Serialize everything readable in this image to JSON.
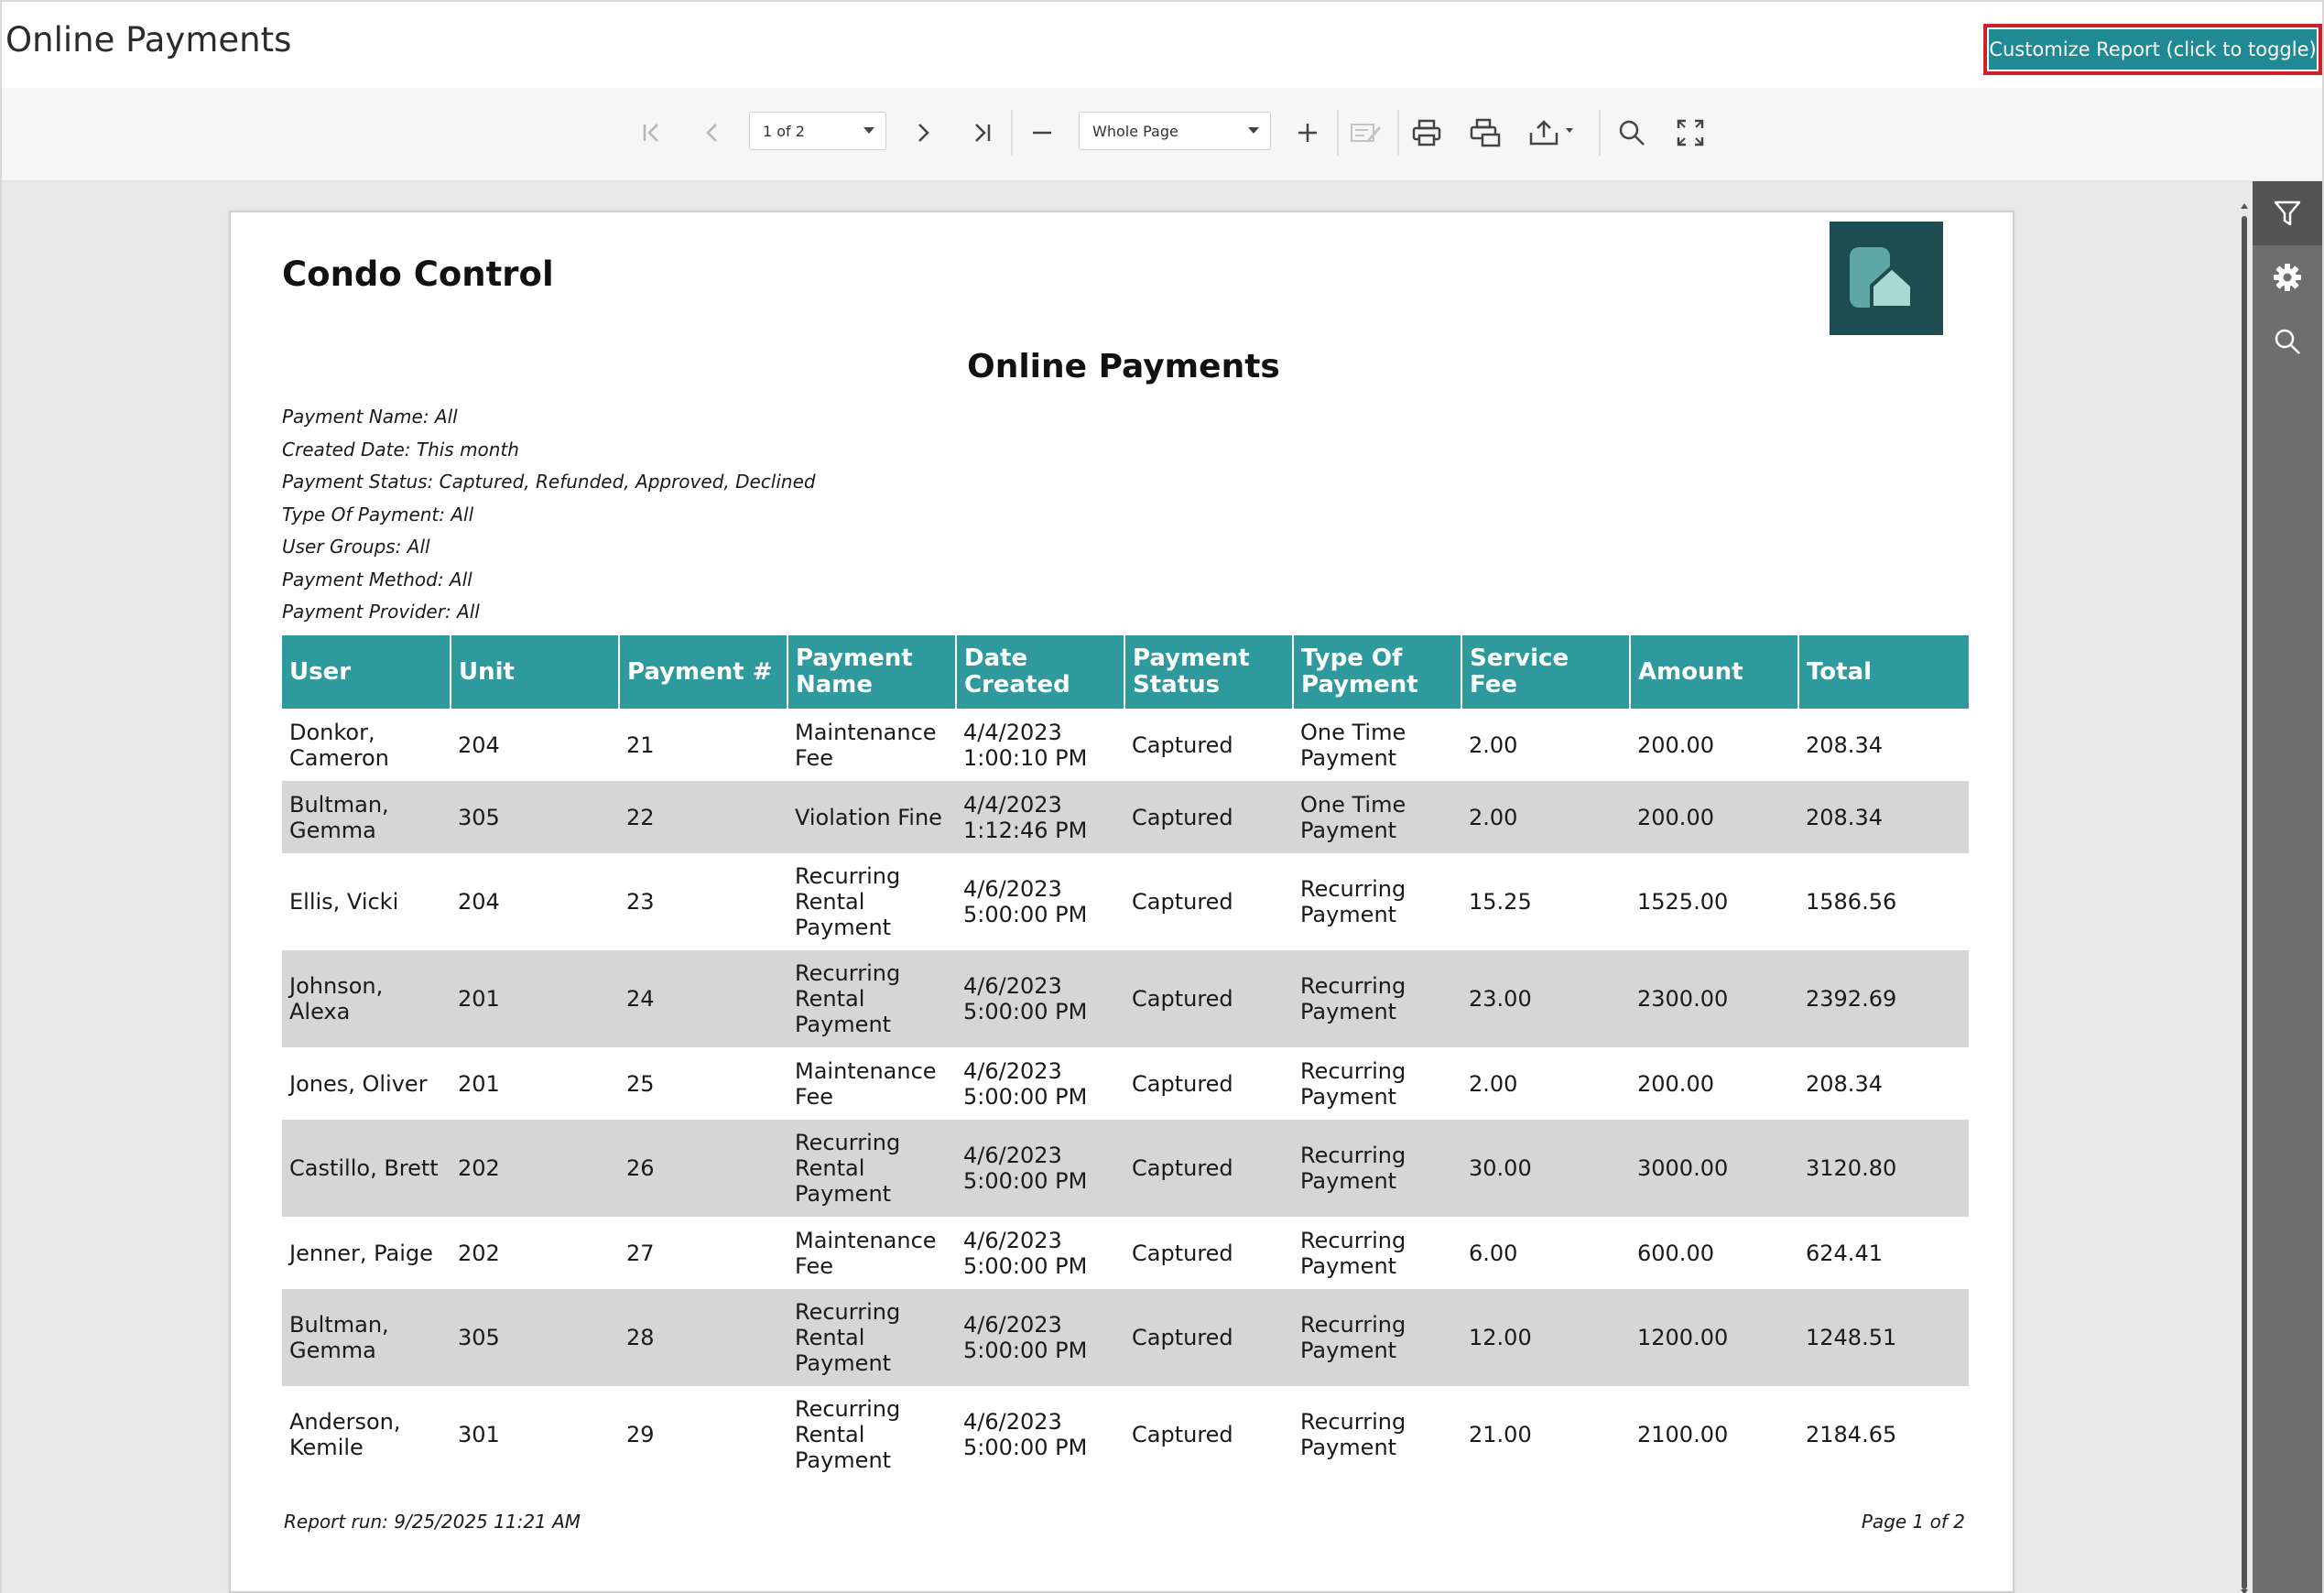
{
  "app": {
    "title": "Online Payments",
    "customize_button": "Customize Report (click to toggle)"
  },
  "toolbar": {
    "page_select": "1 of 2",
    "zoom_select": "Whole Page",
    "icons": [
      "first-page-icon",
      "prev-page-icon",
      "next-page-icon",
      "last-page-icon",
      "zoom-out-icon",
      "zoom-in-icon",
      "edit-fields-icon",
      "print-icon",
      "print-page-icon",
      "export-icon",
      "search-icon",
      "fullscreen-icon"
    ]
  },
  "sidepanel": {
    "icons": [
      "filter-icon",
      "gear-icon",
      "search-icon"
    ]
  },
  "report": {
    "company": "Condo Control",
    "title": "Online Payments",
    "filters": [
      "Payment Name: All",
      "Created Date: This month",
      "Payment Status: Captured, Refunded, Approved, Declined",
      "Type Of Payment: All",
      "User Groups: All",
      "Payment Method: All",
      "Payment Provider: All"
    ],
    "columns": [
      "User",
      "Unit",
      "Payment #",
      "Payment Name",
      "Date Created",
      "Payment Status",
      "Type Of Payment",
      "Service Fee",
      "Amount",
      "Total"
    ],
    "rows": [
      {
        "user": "Donkor, Cameron",
        "unit": "204",
        "payment_no": "21",
        "payment_name": "Maintenance Fee",
        "date_created": "4/4/2023 1:00:10 PM",
        "status": "Captured",
        "type": "One Time Payment",
        "service_fee": "2.00",
        "amount": "200.00",
        "total": "208.34"
      },
      {
        "user": "Bultman, Gemma",
        "unit": "305",
        "payment_no": "22",
        "payment_name": "Violation Fine",
        "date_created": "4/4/2023 1:12:46 PM",
        "status": "Captured",
        "type": "One Time Payment",
        "service_fee": "2.00",
        "amount": "200.00",
        "total": "208.34"
      },
      {
        "user": "Ellis, Vicki",
        "unit": "204",
        "payment_no": "23",
        "payment_name": "Recurring Rental Payment",
        "date_created": "4/6/2023 5:00:00 PM",
        "status": "Captured",
        "type": "Recurring Payment",
        "service_fee": "15.25",
        "amount": "1525.00",
        "total": "1586.56"
      },
      {
        "user": "Johnson, Alexa",
        "unit": "201",
        "payment_no": "24",
        "payment_name": "Recurring Rental Payment",
        "date_created": "4/6/2023 5:00:00 PM",
        "status": "Captured",
        "type": "Recurring Payment",
        "service_fee": "23.00",
        "amount": "2300.00",
        "total": "2392.69"
      },
      {
        "user": "Jones, Oliver",
        "unit": "201",
        "payment_no": "25",
        "payment_name": "Maintenance Fee",
        "date_created": "4/6/2023 5:00:00 PM",
        "status": "Captured",
        "type": "Recurring Payment",
        "service_fee": "2.00",
        "amount": "200.00",
        "total": "208.34"
      },
      {
        "user": "Castillo, Brett",
        "unit": "202",
        "payment_no": "26",
        "payment_name": "Recurring Rental Payment",
        "date_created": "4/6/2023 5:00:00 PM",
        "status": "Captured",
        "type": "Recurring Payment",
        "service_fee": "30.00",
        "amount": "3000.00",
        "total": "3120.80"
      },
      {
        "user": "Jenner, Paige",
        "unit": "202",
        "payment_no": "27",
        "payment_name": "Maintenance Fee",
        "date_created": "4/6/2023 5:00:00 PM",
        "status": "Captured",
        "type": "Recurring Payment",
        "service_fee": "6.00",
        "amount": "600.00",
        "total": "624.41"
      },
      {
        "user": "Bultman, Gemma",
        "unit": "305",
        "payment_no": "28",
        "payment_name": "Recurring Rental Payment",
        "date_created": "4/6/2023 5:00:00 PM",
        "status": "Captured",
        "type": "Recurring Payment",
        "service_fee": "12.00",
        "amount": "1200.00",
        "total": "1248.51"
      },
      {
        "user": "Anderson, Kemile",
        "unit": "301",
        "payment_no": "29",
        "payment_name": "Recurring Rental Payment",
        "date_created": "4/6/2023 5:00:00 PM",
        "status": "Captured",
        "type": "Recurring Payment",
        "service_fee": "21.00",
        "amount": "2100.00",
        "total": "2184.65"
      }
    ],
    "footer_left": "Report run: 9/25/2025 11:21 AM",
    "footer_right": "Page 1 of 2"
  },
  "colors": {
    "accent": "#1f8a94",
    "table_header": "#2e9a9d",
    "logo_bg": "#1f4c4f",
    "row_alt": "#d6d6d6",
    "highlight_border": "#d0202a"
  }
}
